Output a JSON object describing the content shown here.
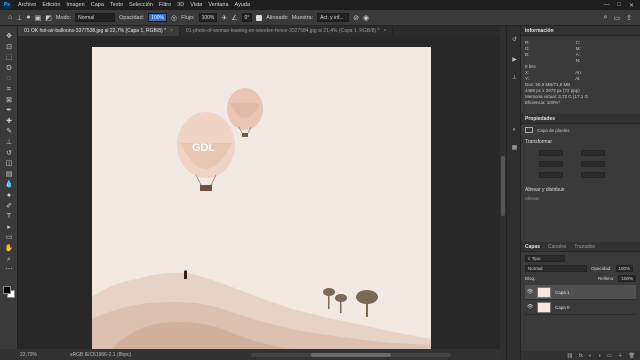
{
  "app": {
    "logo": "Ps"
  },
  "menu": [
    "Archivo",
    "Edición",
    "Imagen",
    "Capa",
    "Texto",
    "Selección",
    "Filtro",
    "3D",
    "Vista",
    "Ventana",
    "Ayuda"
  ],
  "window_controls": [
    "—",
    "□",
    "✕"
  ],
  "options": {
    "mode_label": "Modo:",
    "mode_value": "Normal",
    "opacity_label": "Opacidad:",
    "opacity_value": "100%",
    "flow_label": "Flujo:",
    "flow_value": "100%",
    "angle_value": "0°",
    "aligned_label": "Alineado",
    "sample_label": "Muestra:",
    "sample_value": "Act. y inf...",
    "icons": [
      "home-icon",
      "clone-stamp-icon",
      "brush-preset-icon",
      "toggle-panel-icon",
      "airbrush-icon",
      "pressure-icon",
      "search-icon",
      "workspace-icon",
      "share-icon"
    ]
  },
  "tabs": [
    {
      "label": "01 OK hot-air-balloons-3377538.jpg al 22,7% (Capa 1, RGB/8) *",
      "active": true,
      "close": "×"
    },
    {
      "label": "01-photo-of-woman-leaning-on-wooden-fence-3327584.jpg al 21,4% (Capa 1, RGB/8) *",
      "active": false,
      "close": "×"
    }
  ],
  "tools": [
    "move-icon",
    "artboard-icon",
    "marquee-icon",
    "lasso-icon",
    "quick-select-icon",
    "crop-icon",
    "frame-icon",
    "eyedropper-icon",
    "healing-icon",
    "brush-icon",
    "clone-stamp-icon",
    "history-brush-icon",
    "eraser-icon",
    "gradient-icon",
    "blur-icon",
    "dodge-icon",
    "pen-icon",
    "type-icon",
    "path-select-icon",
    "shape-icon",
    "hand-icon",
    "zoom-icon",
    "edit-toolbar-icon"
  ],
  "tool_glyphs": [
    "✥",
    "⊡",
    "⬚",
    "ʘ",
    "◌",
    "⌗",
    "⊠",
    "✒",
    "✚",
    "✎",
    "⊥",
    "↺",
    "◫",
    "▤",
    "💧",
    "●",
    "✐",
    "T",
    "▸",
    "▭",
    "✋",
    "⌕",
    "⋯"
  ],
  "status": {
    "zoom": "22,73%",
    "profile": "sRGB IEC61966-2.1 (8bpc)"
  },
  "panels": {
    "info": {
      "title": "Información",
      "r_label": "R:",
      "g_label": "G:",
      "b_label": "B:",
      "c_label": "C:",
      "m_label": "M:",
      "y_label": "A:",
      "k_label": "N:",
      "bits": "8 bits",
      "x_label": "X:",
      "y2_label": "Y:",
      "w_label": "An:",
      "h_label": "Al:",
      "doc": "Doc: 50,9 MB/71,8 MB",
      "size": "4480 px x 2972 px (72 ppp)",
      "scratch": "Memoria virtual: 3,72 G (17,1 G",
      "efficiency": "Eficiencia: 100%*"
    },
    "properties": {
      "title": "Propiedades",
      "kind": "Capa de píxeles",
      "transform": "Transformar",
      "align": "Alinear y distribuir",
      "align_sub": "Alinear:"
    },
    "layers": {
      "tabs": [
        "Capas",
        "Canales",
        "Trazados"
      ],
      "filter_value": "Tipo",
      "blend_value": "Normal",
      "opacity_label": "Opacidad:",
      "opacity_value": "100%",
      "lock_label": "Bloq.:",
      "fill_label": "Relleno:",
      "fill_value": "100%",
      "items": [
        {
          "name": "Capa 1",
          "selected": true,
          "visible": "👁"
        },
        {
          "name": "Capa 0",
          "selected": false,
          "visible": "👁"
        }
      ],
      "bottom_icons": [
        "link-icon",
        "fx-icon",
        "mask-icon",
        "adjustment-icon",
        "group-icon",
        "new-layer-icon",
        "trash-icon"
      ],
      "bottom_glyphs": [
        "⛓",
        "fx",
        "◐",
        "◑",
        "▭",
        "＋",
        "🗑"
      ]
    }
  }
}
